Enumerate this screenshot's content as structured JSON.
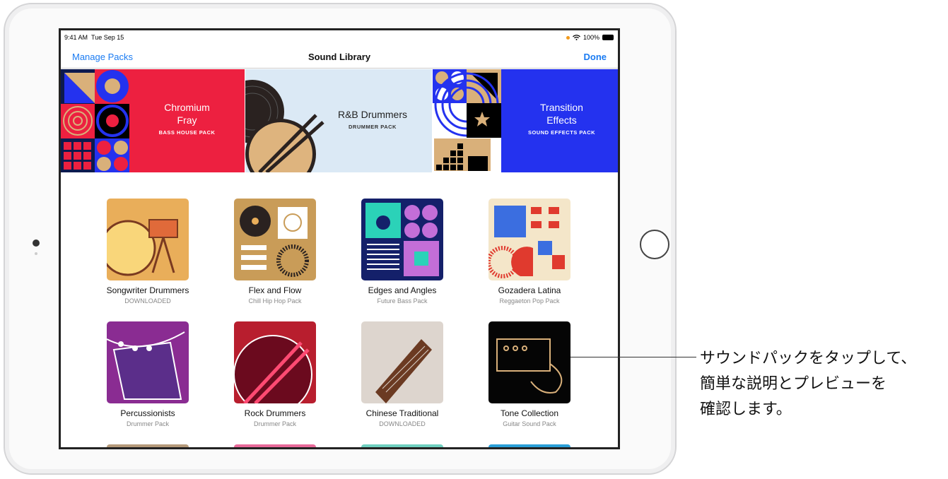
{
  "status": {
    "time": "9:41 AM",
    "date": "Tue Sep 15",
    "battery": "100%"
  },
  "nav": {
    "left": "Manage Packs",
    "title": "Sound Library",
    "right": "Done"
  },
  "banners": [
    {
      "name": "Chromium\nFray",
      "line1": "Chromium",
      "line2": "Fray",
      "sub": "BASS HOUSE PACK",
      "color": "#ed2040"
    },
    {
      "line1": "R&B Drummers",
      "sub": "DRUMMER PACK",
      "color": "#dbe9f5"
    },
    {
      "line1": "Transition",
      "line2": "Effects",
      "sub": "SOUND EFFECTS PACK",
      "color": "#2432ef"
    }
  ],
  "packs": [
    {
      "name": "Songwriter Drummers",
      "sub": "DOWNLOADED",
      "color": "#e9ae5a"
    },
    {
      "name": "Flex and Flow",
      "sub": "Chill Hip Hop Pack",
      "color": "#c99c58"
    },
    {
      "name": "Edges and Angles",
      "sub": "Future Bass Pack",
      "color": "#14206a"
    },
    {
      "name": "Gozadera Latina",
      "sub": "Reggaeton Pop Pack",
      "color": "#f4e6c9"
    },
    {
      "name": "Percussionists",
      "sub": "Drummer Pack",
      "color": "#8a2c92"
    },
    {
      "name": "Rock Drummers",
      "sub": "Drummer Pack",
      "color": "#b81e2e"
    },
    {
      "name": "Chinese Traditional",
      "sub": "DOWNLOADED",
      "color": "#ddd5ce"
    },
    {
      "name": "Tone Collection",
      "sub": "Guitar Sound Pack",
      "color": "#050505"
    }
  ],
  "callout": {
    "line1": "サウンドパックをタップして、",
    "line2": "簡単な説明とプレビューを",
    "line3": "確認します。"
  }
}
